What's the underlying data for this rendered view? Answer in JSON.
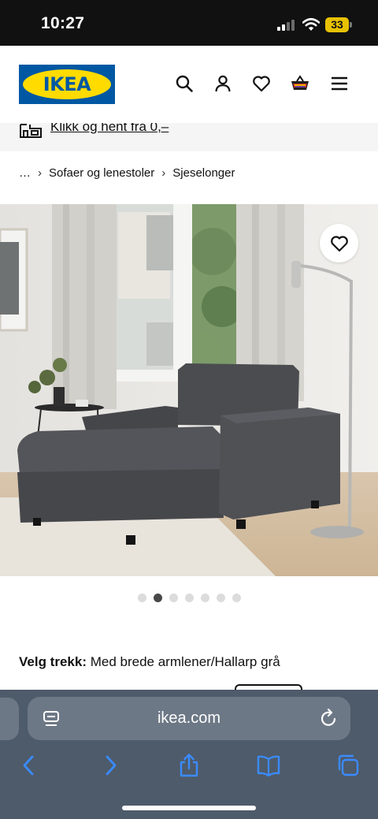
{
  "status_bar": {
    "time": "10:27",
    "battery": "33"
  },
  "header": {
    "logo_text": "IKEA",
    "icons": [
      "search-icon",
      "account-icon",
      "favorites-icon",
      "cart-icon",
      "menu-icon"
    ]
  },
  "click_collect": {
    "text": "Klikk og hent fra 0,–"
  },
  "breadcrumb": {
    "ellipsis": "…",
    "items": [
      "Sofaer og lenestoler",
      "Sjeselonger"
    ]
  },
  "carousel": {
    "total": 7,
    "active_index": 1
  },
  "product": {
    "cover_label": "Velg trekk:",
    "cover_value": "Med brede armlener/Hallarp grå"
  },
  "browser": {
    "url": "ikea.com"
  },
  "colors": {
    "ikea_blue": "#0058a3",
    "ikea_yellow": "#ffdb00",
    "safari_bar": "#4e5b6a",
    "battery": "#e8c200"
  }
}
